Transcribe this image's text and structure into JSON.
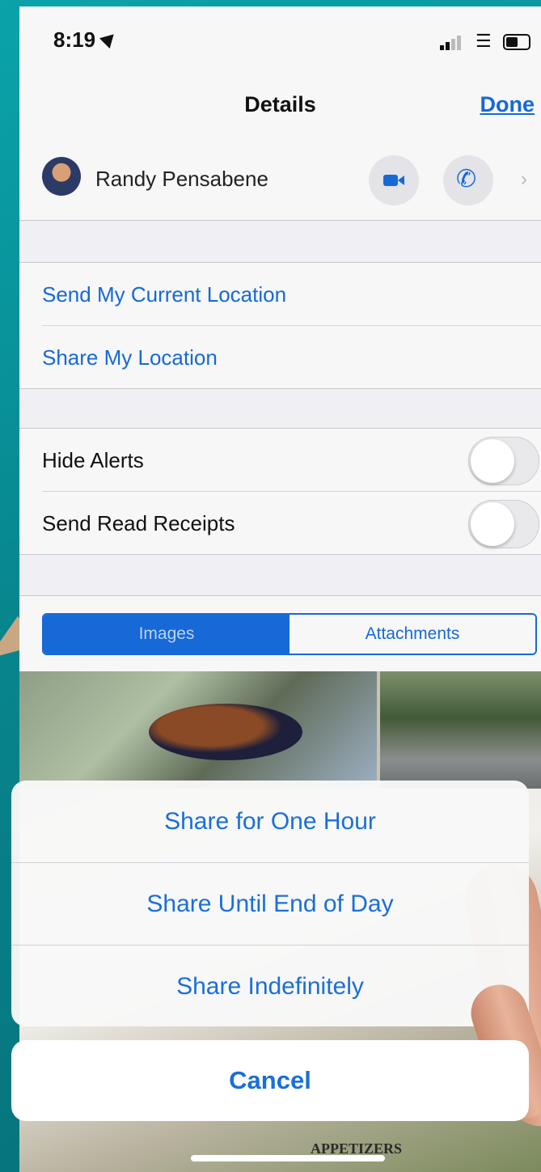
{
  "status_bar": {
    "time": "8:19"
  },
  "nav": {
    "title": "Details",
    "done_label": "Done"
  },
  "contact": {
    "name": "Randy Pensabene"
  },
  "location_group": {
    "send_current_location": "Send My Current Location",
    "share_location": "Share My Location"
  },
  "settings_group": {
    "hide_alerts": {
      "label": "Hide Alerts",
      "on": false
    },
    "send_read_receipts": {
      "label": "Send Read Receipts",
      "on": false
    }
  },
  "segments": {
    "images": "Images",
    "attachments": "Attachments",
    "selected": "Images"
  },
  "photo_text": "APPETIZERS",
  "action_sheet": {
    "options": [
      "Share for One Hour",
      "Share Until End of Day",
      "Share Indefinitely"
    ],
    "cancel": "Cancel"
  },
  "colors": {
    "accent": "#1669d6",
    "background_frame": "#0a8c93"
  }
}
